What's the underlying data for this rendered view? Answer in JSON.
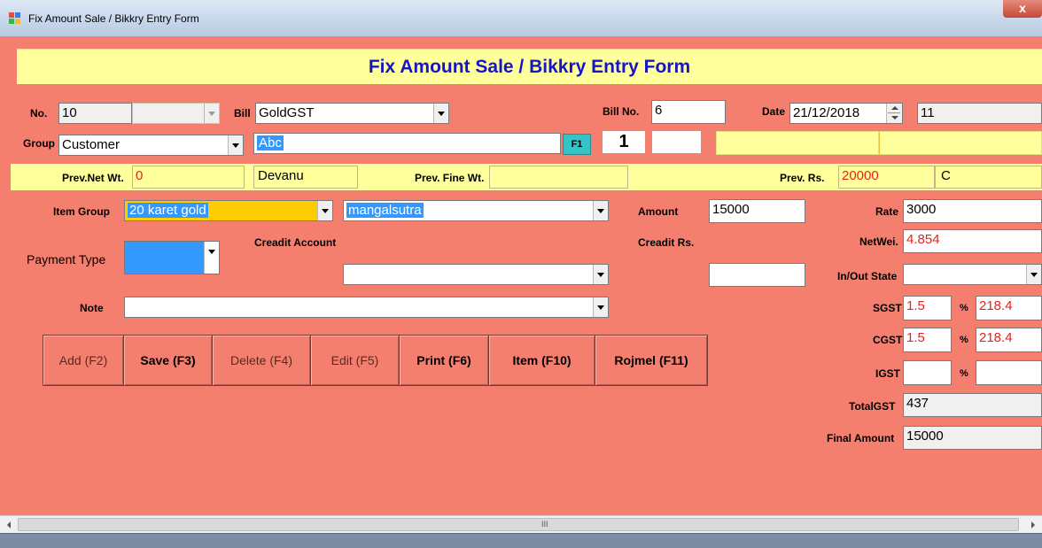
{
  "window": {
    "title": "Fix Amount Sale / Bikkry Entry Form",
    "close_glyph": "x"
  },
  "banner": "Fix Amount Sale / Bikkry Entry Form",
  "row1": {
    "no_label": "No.",
    "no_value": "10",
    "bill_label": "Bill",
    "bill_value": "GoldGST",
    "billno_label": "Bill No.",
    "billno_value": "6",
    "date_label": "Date",
    "date_value": "21/12/2018",
    "extra_value": "11"
  },
  "row2": {
    "group_label": "Group",
    "group_value": "Customer",
    "party_value": "Abc",
    "f1_label": "F1",
    "count_value": "1"
  },
  "row3": {
    "prev_net_label": "Prev.Net Wt.",
    "prev_net_value": "0",
    "name_value": "Devanu",
    "prev_fine_label": "Prev. Fine Wt.",
    "prev_rs_label": "Prev. Rs.",
    "prev_rs_value": "20000",
    "cr_value": "C"
  },
  "item": {
    "group_label": "Item Group",
    "group_value": "20 karet gold",
    "item_value": "mangalsutra",
    "amount_label": "Amount",
    "amount_value": "15000"
  },
  "payment": {
    "type_label": "Payment Type",
    "credit_account_label": "Creadit Account",
    "credit_rs_label": "Creadit Rs.",
    "note_label": "Note"
  },
  "right": {
    "rate_label": "Rate",
    "rate_value": "3000",
    "netwei_label": "NetWei.",
    "netwei_value": "4.854",
    "inout_label": "In/Out State",
    "sgst_label": "SGST",
    "sgst_pct": "1.5",
    "sgst_amt": "218.4",
    "cgst_label": "CGST",
    "cgst_pct": "1.5",
    "cgst_amt": "218.4",
    "igst_label": "IGST",
    "pct_sign": "%",
    "totalgst_label": "TotalGST",
    "totalgst_value": "437",
    "final_label": "Final Amount",
    "final_value": "15000"
  },
  "buttons": {
    "add": "Add (F2)",
    "save": "Save (F3)",
    "delete": "Delete (F4)",
    "edit": "Edit (F5)",
    "print": "Print (F6)",
    "item": "Item (F10)",
    "rojmel": "Rojmel (F11)"
  },
  "scroll": {
    "grip": "III"
  },
  "colors": {
    "form_bg": "#f47f6f",
    "banner_bg": "#ffff9c",
    "banner_text": "#1515c8",
    "highlight": "#3399ff",
    "red_value": "#e8201a"
  }
}
